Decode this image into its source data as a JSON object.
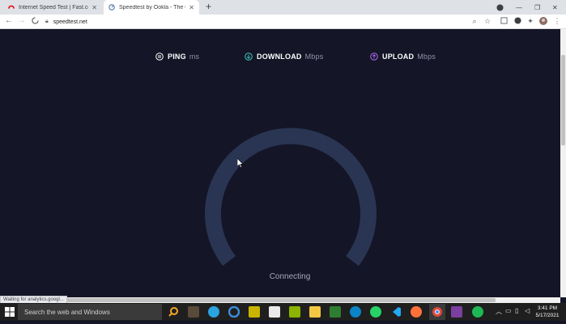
{
  "browser": {
    "tabs": [
      {
        "title": "Internet Speed Test | Fast.com",
        "active": false
      },
      {
        "title": "Speedtest by Ookla - The Globa",
        "active": true
      }
    ],
    "new_tab": "+",
    "url": "speedtest.net",
    "status_text": "Waiting for analytics.googl..."
  },
  "speedtest": {
    "ping_label": "PING",
    "ping_unit": "ms",
    "download_label": "DOWNLOAD",
    "download_unit": "Mbps",
    "upload_label": "UPLOAD",
    "upload_unit": "Mbps",
    "state": "Connecting",
    "colors": {
      "background": "#141526",
      "gauge": "#2a3553",
      "download": "#40c8c0",
      "upload": "#b36cf5"
    }
  },
  "taskbar": {
    "search_placeholder": "Search the web and Windows",
    "time": "3:41 PM",
    "date": "5/17/2021"
  }
}
